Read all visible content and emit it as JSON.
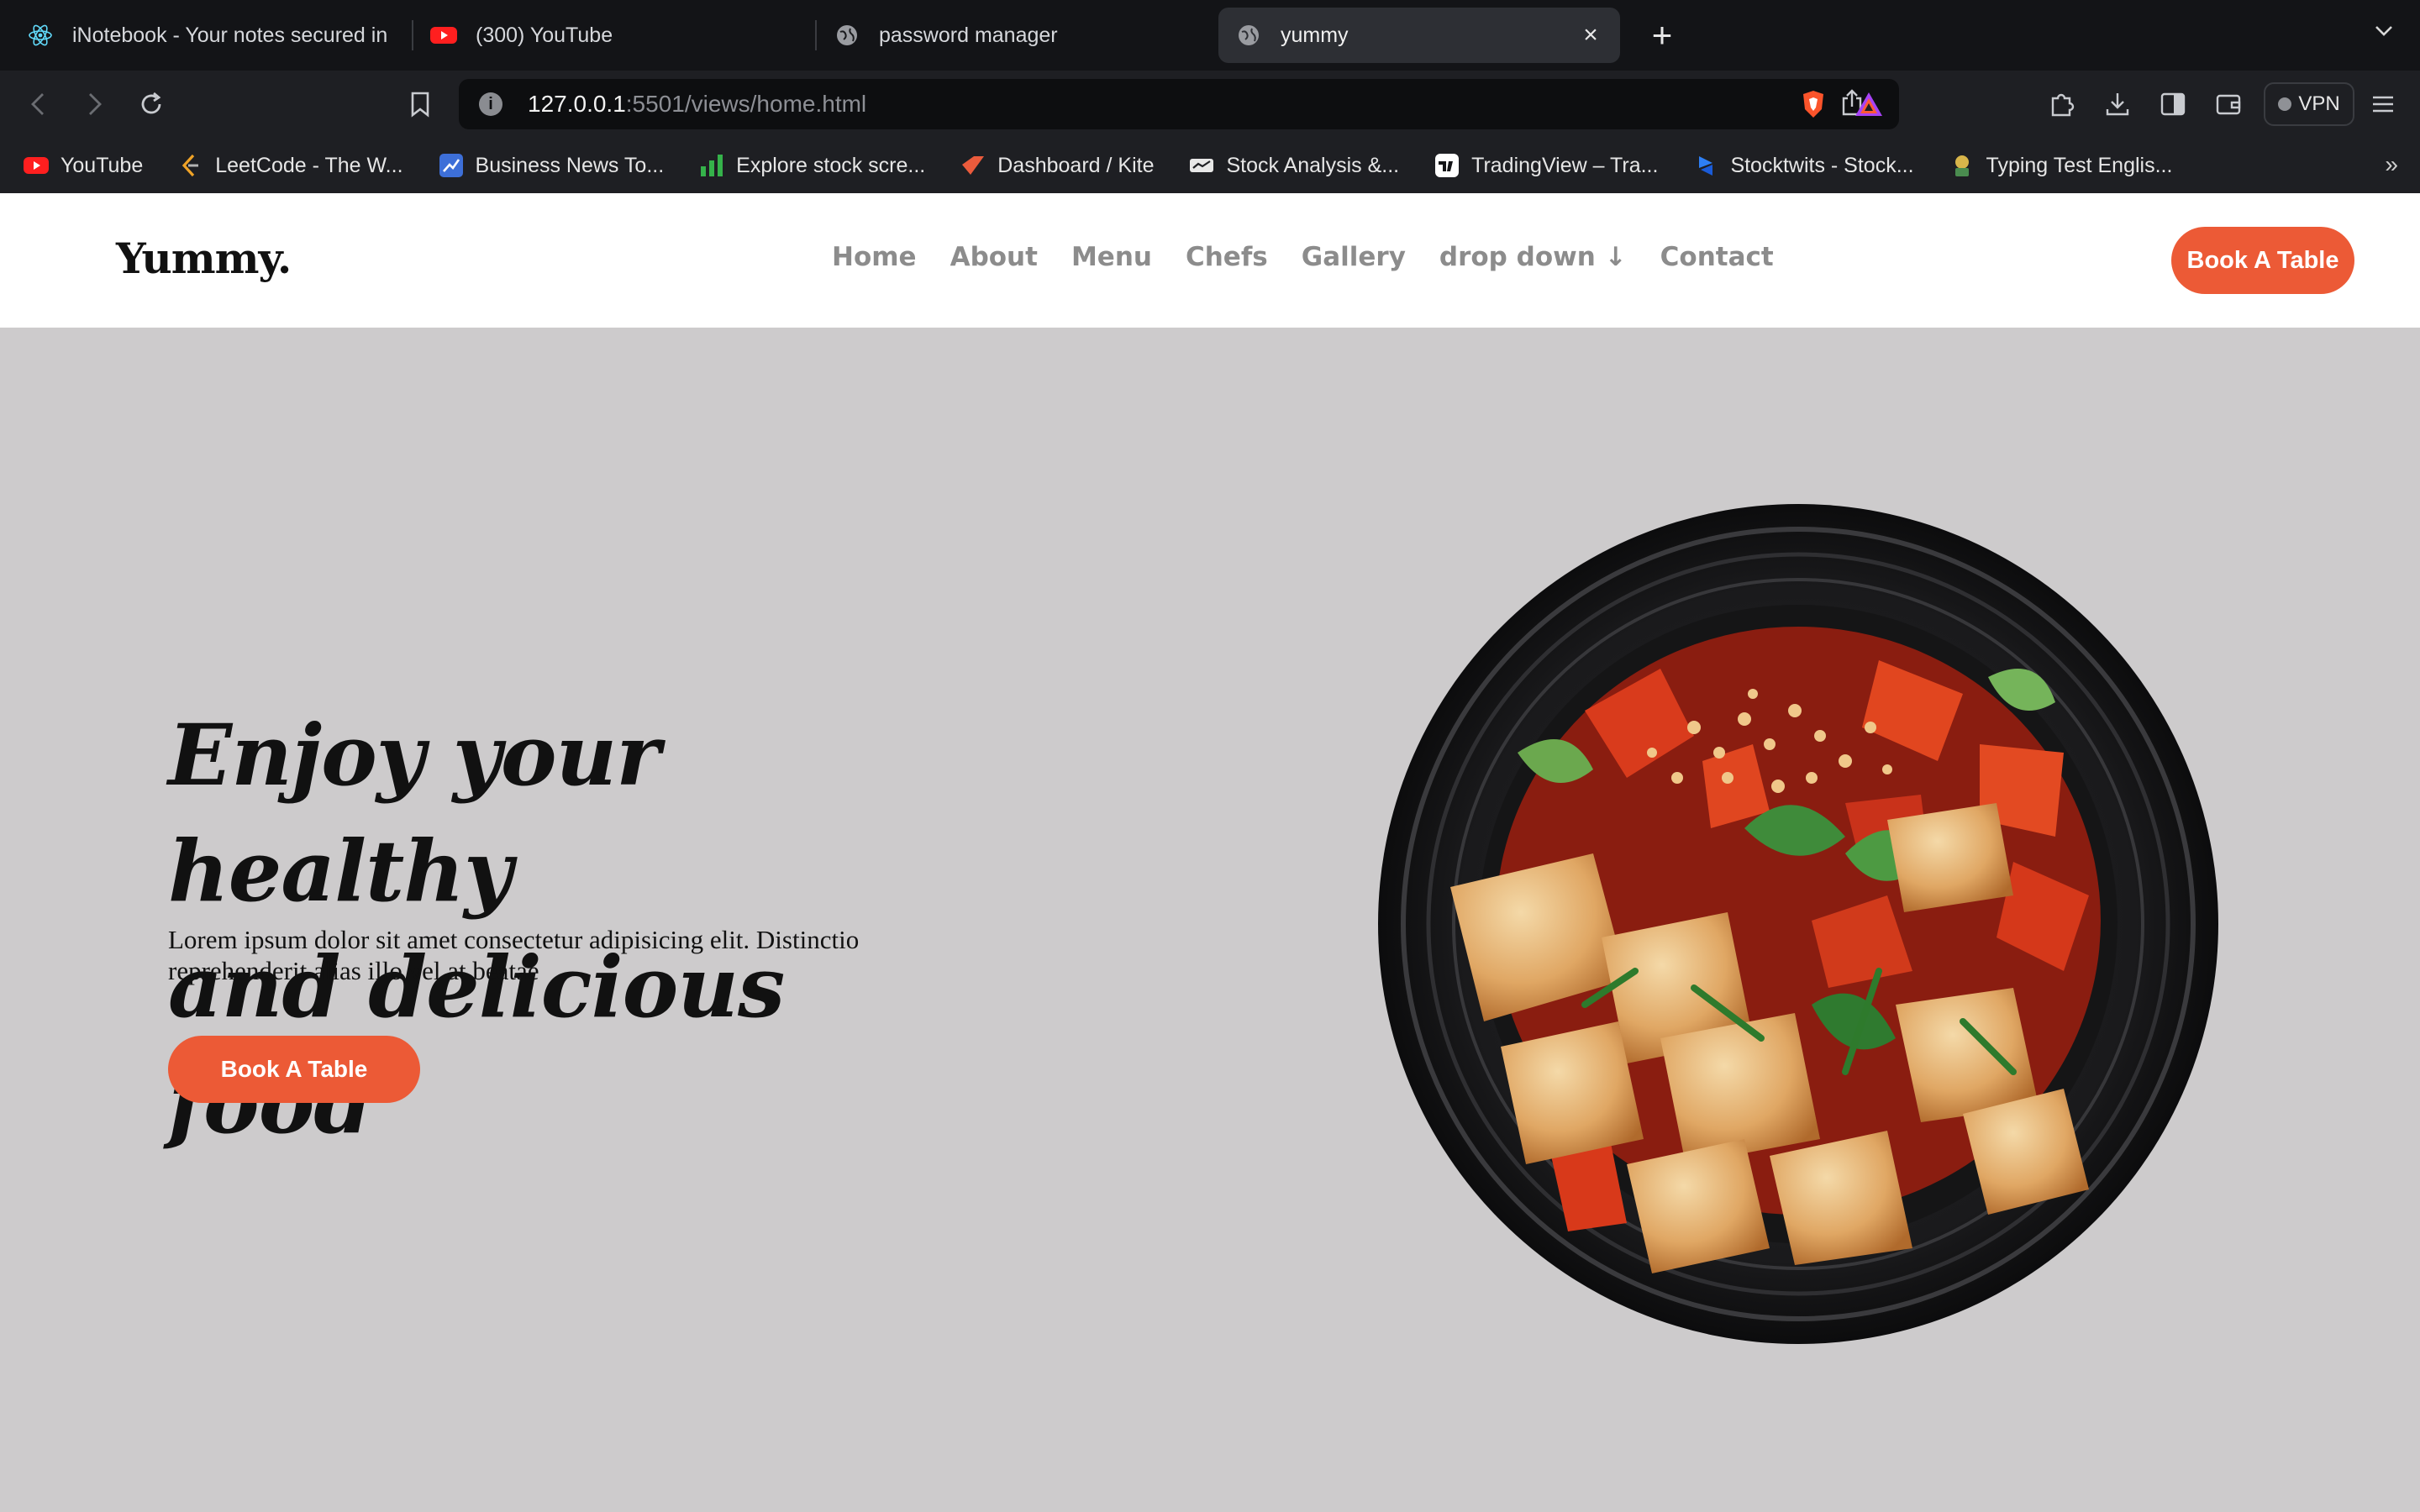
{
  "browser": {
    "tabs": [
      {
        "title": "iNotebook - Your notes secured in",
        "icon": "react-icon",
        "active": false
      },
      {
        "title": "(300) YouTube",
        "icon": "youtube-icon",
        "active": false
      },
      {
        "title": "password manager",
        "icon": "globe-icon",
        "active": false
      },
      {
        "title": "yummy",
        "icon": "globe-icon",
        "active": true
      }
    ],
    "url_host": "127.0.0.1",
    "url_path": ":5501/views/home.html",
    "vpn_label": "VPN",
    "bookmarks": [
      {
        "label": "YouTube",
        "icon": "youtube-icon"
      },
      {
        "label": "LeetCode - The W...",
        "icon": "leetcode-icon"
      },
      {
        "label": "Business News To...",
        "icon": "business-news-icon"
      },
      {
        "label": "Explore stock scre...",
        "icon": "stock-bars-icon"
      },
      {
        "label": "Dashboard / Kite",
        "icon": "kite-icon"
      },
      {
        "label": "Stock Analysis &...",
        "icon": "stock-analysis-icon"
      },
      {
        "label": "TradingView – Tra...",
        "icon": "tradingview-icon"
      },
      {
        "label": "Stocktwits - Stock...",
        "icon": "stocktwits-icon"
      },
      {
        "label": "Typing Test Englis...",
        "icon": "typing-test-icon"
      }
    ],
    "colors": {
      "tabbar": "#131417",
      "toolbar": "#1e1f23",
      "active_tab": "#2d2f34"
    }
  },
  "site": {
    "logo": "Yummy.",
    "nav": [
      "Home",
      "About",
      "Menu",
      "Chefs",
      "Gallery",
      "drop down ↓",
      "Contact"
    ],
    "header_button": "Book A Table",
    "hero": {
      "title_line1": "Enjoy your healthy",
      "title_line2": "and delicious food",
      "text": "Lorem ipsum dolor sit amet consectetur adipisicing elit. Distinctio reprehenderit alias illo vel at beatae",
      "button": "Book A Table"
    },
    "colors": {
      "accent": "#ec5a36",
      "hero_bg": "#cdcbcc",
      "nav_text": "#8c8c8c"
    }
  }
}
